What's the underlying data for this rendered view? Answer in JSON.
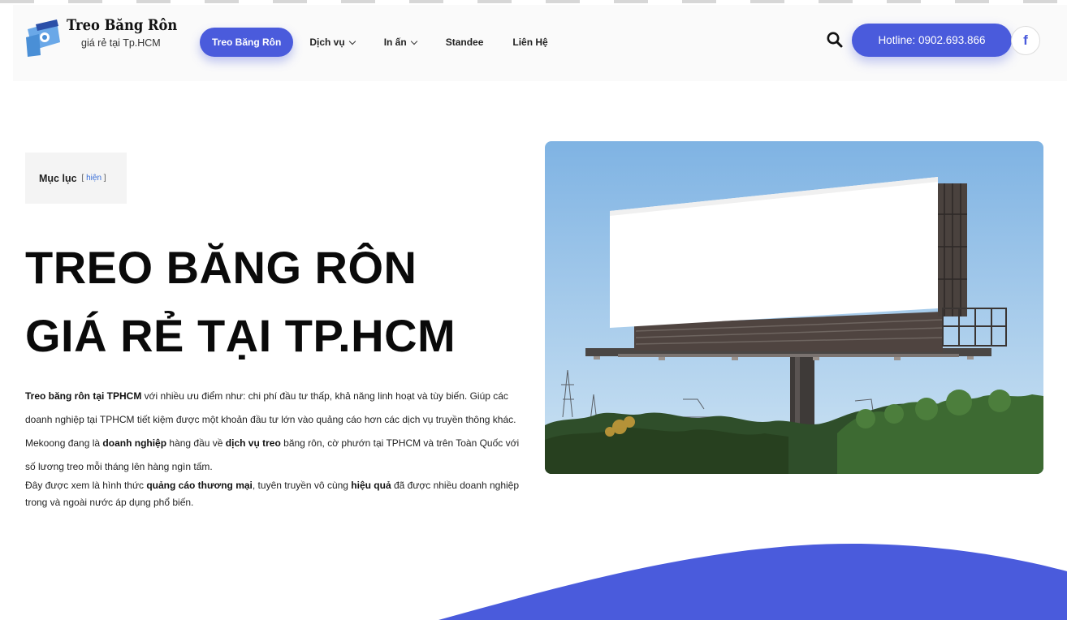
{
  "header": {
    "logo": {
      "title": "Treo Băng Rôn",
      "subtitle": "giá rẻ tại Tp.HCM"
    },
    "nav": [
      {
        "label": "Treo Băng Rôn",
        "active": true,
        "dropdown": false
      },
      {
        "label": "Dịch vụ",
        "active": false,
        "dropdown": true
      },
      {
        "label": "In ấn",
        "active": false,
        "dropdown": true
      },
      {
        "label": "Standee",
        "active": false,
        "dropdown": false
      },
      {
        "label": "Liên Hệ",
        "active": false,
        "dropdown": false
      }
    ],
    "search_icon": "search-icon",
    "hotline_label": "Hotline: 0902.693.866",
    "facebook_glyph": "f"
  },
  "toc": {
    "title": "Mục lục",
    "bracket_open": "[",
    "toggle_label": "hiện",
    "bracket_close": "]"
  },
  "hero": {
    "title_line1": "TREO BĂNG RÔN",
    "title_line2": "GIÁ RẺ TẠI TP.HCM"
  },
  "intro": {
    "p1": [
      {
        "text": "Treo băng rôn tại TPHCM",
        "bold": true
      },
      {
        "text": " với nhiều ưu điểm như: chi phí đầu tư thấp, khả năng linh hoạt và tùy biến. Giúp các doanh nghiệp tại TPHCM tiết kiệm được một khoản đầu tư lớn vào quảng cáo hơn các dịch vụ truyền thông khác. Mekoong đang là ",
        "bold": false
      },
      {
        "text": "doanh nghiệp",
        "bold": true
      },
      {
        "text": " hàng đầu về ",
        "bold": false
      },
      {
        "text": "dịch vụ treo",
        "bold": true
      },
      {
        "text": " băng rôn, cờ phướn tại TPHCM và trên Toàn Quốc với số lương treo mỗi tháng lên hàng ngìn tấm.",
        "bold": false
      }
    ],
    "p2": [
      {
        "text": "Đây được xem là hình thức ",
        "bold": false
      },
      {
        "text": "quảng cáo thương mại",
        "bold": true
      },
      {
        "text": ", tuyên truyền vô cùng ",
        "bold": false
      },
      {
        "text": "hiệu quả",
        "bold": true
      },
      {
        "text": " đã được nhiều doanh nghiệp trong và ngoài nước áp dụng phổ biến.",
        "bold": false
      }
    ]
  },
  "colors": {
    "accent": "#4a5bdc",
    "link": "#3a6fd8",
    "sky_top": "#7fb3e3",
    "sky_bottom": "#cde3f3"
  }
}
